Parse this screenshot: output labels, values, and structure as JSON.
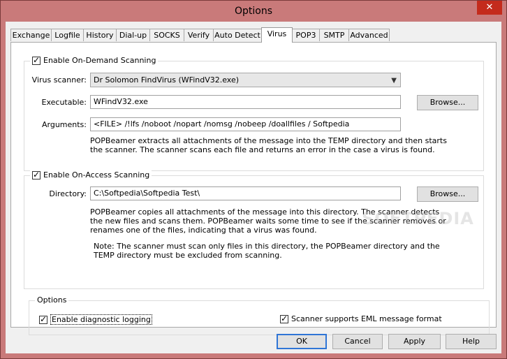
{
  "window": {
    "title": "Options",
    "close_glyph": "✕"
  },
  "tabs": [
    "Exchange",
    "Logfile",
    "History",
    "Dial-up",
    "SOCKS",
    "Verify",
    "Auto Detect",
    "Virus",
    "POP3",
    "SMTP",
    "Advanced"
  ],
  "active_tab": "Virus",
  "on_demand": {
    "caption": "Enable On-Demand Scanning",
    "checked": true,
    "scanner_label": "Virus scanner:",
    "scanner_value": "Dr Solomon FindVirus (WFindV32.exe)",
    "executable_label": "Executable:",
    "executable_value": "WFindV32.exe",
    "browse_label": "Browse...",
    "arguments_label": "Arguments:",
    "arguments_value": "<FILE> /!lfs /noboot /nopart /nomsg /nobeep /doallfiles / Softpedia",
    "description_line1": "POPBeamer extracts all attachments of the message into the TEMP directory and then starts",
    "description_line2": "the scanner. The scanner scans each file and returns an error in the case a virus is found."
  },
  "on_access": {
    "caption": "Enable On-Access Scanning",
    "checked": true,
    "directory_label": "Directory:",
    "directory_value": "C:\\Softpedia\\Softpedia Test\\",
    "browse_label": "Browse...",
    "description_line1": "POPBeamer copies all attachments of the message into this directory. The scanner detects",
    "description_line2": "the new files and scans them. POPBeamer waits some time to see if the scanner removes or",
    "description_line3": "renames one of the files, indicating that a virus was found.",
    "note_line1": "Note: The scanner must scan only files in this directory, the POPBeamer directory and the",
    "note_line2": "TEMP directory must be excluded from scanning."
  },
  "options": {
    "caption": "Options",
    "diagnostic_label": "Enable diagnostic logging",
    "diagnostic_checked": true,
    "eml_label": "Scanner supports EML message format",
    "eml_checked": true
  },
  "footer": {
    "ok": "OK",
    "cancel": "Cancel",
    "apply": "Apply",
    "help": "Help"
  },
  "watermark": "SOFTPEDIA"
}
